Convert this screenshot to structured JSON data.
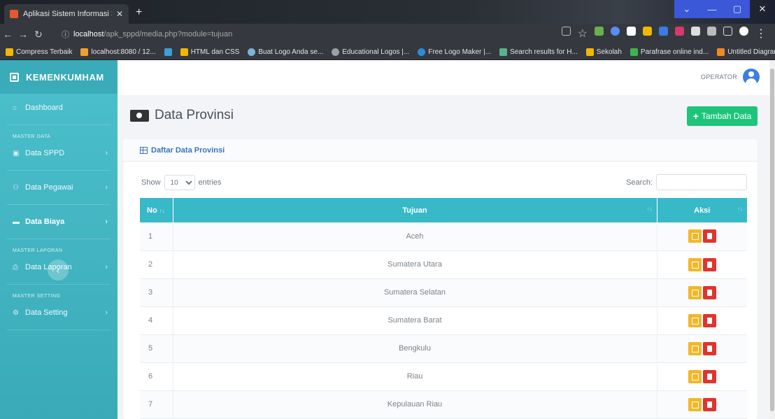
{
  "browser": {
    "tab_title": "Aplikasi Sistem Informasi Surat P",
    "url_host": "localhost",
    "url_path": "/apk_sppd/media.php?module=tujuan",
    "bookmarks": [
      {
        "label": "Compress Terbaik",
        "color": "#f2b705"
      },
      {
        "label": "localhost:8080 / 12...",
        "color": "#f0a030"
      },
      {
        "label": "",
        "color": "#3aa0d8"
      },
      {
        "label": "HTML dan CSS",
        "color": "#f2b705"
      },
      {
        "label": "Buat Logo Anda se...",
        "color": "#7fb3d5"
      },
      {
        "label": "Educational Logos |...",
        "color": "#9aa0a6"
      },
      {
        "label": "Free Logo Maker |...",
        "color": "#2d8ad6"
      },
      {
        "label": "Search results for H...",
        "color": "#56b38a"
      },
      {
        "label": "Sekolah",
        "color": "#f2b705"
      },
      {
        "label": "Parafrase online ind...",
        "color": "#3cb54a"
      },
      {
        "label": "Untitled Diagram -...",
        "color": "#f08a24"
      }
    ]
  },
  "sidebar": {
    "brand": "KEMENKUMHAM",
    "items": [
      {
        "label": "Dashboard",
        "icon": "⌂",
        "section": ""
      },
      {
        "label": "Data SPPD",
        "icon": "▣",
        "section": "MASTER DATA"
      },
      {
        "label": "Data Pegawai",
        "icon": "⚇",
        "section": ""
      },
      {
        "label": "Data Biaya",
        "icon": "▬",
        "section": ""
      },
      {
        "label": "Data Laporan",
        "icon": "⎙",
        "section": "MASTER LAPORAN"
      },
      {
        "label": "Data Setting",
        "icon": "⚙",
        "section": "MASTER SETTING"
      }
    ],
    "section_master_data": "MASTER DATA",
    "section_master_laporan": "MASTER LAPORAN",
    "section_master_setting": "MASTER SETTING",
    "collapse": "‹"
  },
  "header": {
    "user_role": "OPERATOR"
  },
  "page": {
    "title": "Data Provinsi",
    "add_button": "Tambah Data",
    "card_title": "Daftar Data Provinsi",
    "show_label": "Show",
    "entries_value": "10",
    "entries_label": "entries",
    "search_label": "Search:"
  },
  "table": {
    "headers": {
      "no": "No",
      "tujuan": "Tujuan",
      "aksi": "Aksi"
    },
    "rows": [
      {
        "no": "1",
        "tujuan": "Aceh"
      },
      {
        "no": "2",
        "tujuan": "Sumatera Utara"
      },
      {
        "no": "3",
        "tujuan": "Sumatera Selatan"
      },
      {
        "no": "4",
        "tujuan": "Sumatera Barat"
      },
      {
        "no": "5",
        "tujuan": "Bengkulu"
      },
      {
        "no": "6",
        "tujuan": "Riau"
      },
      {
        "no": "7",
        "tujuan": "Kepulauan Riau"
      }
    ]
  },
  "colors": {
    "sidebar": "#44b7c4",
    "table_header": "#38b9c8",
    "add_button": "#1ec47a",
    "edit_button": "#f4b62a",
    "delete_button": "#e0342d"
  }
}
